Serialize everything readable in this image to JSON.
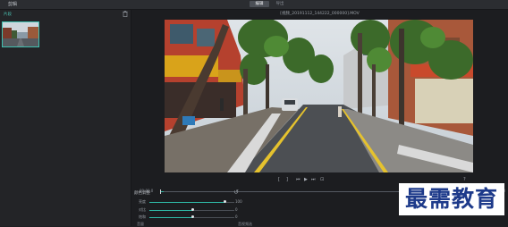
{
  "app": {
    "title": "剪辑"
  },
  "tabs": [
    {
      "label": "编辑"
    },
    {
      "label": "导出"
    }
  ],
  "library": {
    "header": "片段",
    "trash_icon": "trash-icon"
  },
  "preview": {
    "filename": "[视频_20191112_144222_000000].MOV"
  },
  "timeline": {
    "current": "00:00.0",
    "end": "00:00",
    "progress": 0.01
  },
  "adjust": {
    "title": "颜色调整",
    "rows": [
      {
        "name": "亮度",
        "value": "100",
        "level": 0.88
      },
      {
        "name": "对比",
        "value": "0",
        "level": 0.5
      },
      {
        "name": "饱和",
        "value": "0",
        "level": 0.5
      }
    ]
  },
  "footer": {
    "left": "音量",
    "right": "音视频选"
  },
  "watermark": "最需教育",
  "colors": {
    "accent": "#2fb8a5",
    "background": "#1e1f22",
    "watermark": "#1d3a8a"
  }
}
